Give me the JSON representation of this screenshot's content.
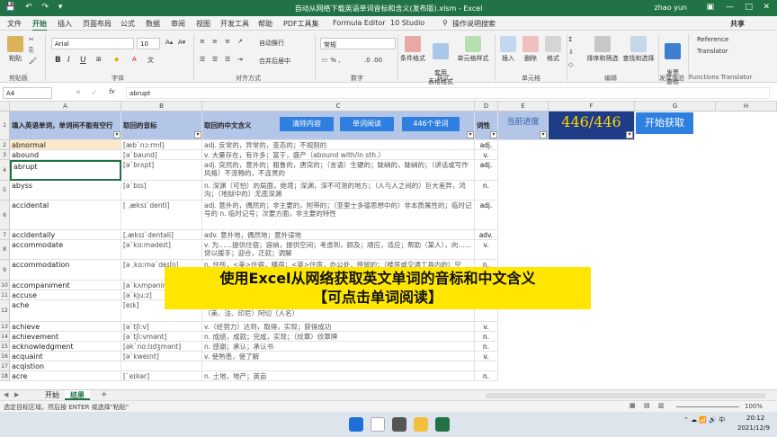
{
  "title_bar": {
    "title": "自动从网络下载英语单词音标和含义(发布版).xlsm - Excel",
    "user": "zhao yun",
    "minimize": "—",
    "maximize": "□",
    "close": "✕",
    "ribbon_display": "▣"
  },
  "quick_access": "💾 ↶ ↷ ▾",
  "tabs": [
    "文件",
    "开始",
    "插入",
    "页面布局",
    "公式",
    "数据",
    "审阅",
    "视图",
    "开发工具",
    "帮助",
    "PDF工具集",
    "Formula Editor",
    "10 Studio",
    "操作说明搜索"
  ],
  "share_label": "共享",
  "ribbon": {
    "paste": "粘贴",
    "font_name": "Arial",
    "font_size": "10",
    "bold": "B",
    "italic": "I",
    "underline": "U",
    "wrap": "自动换行",
    "merge": "合并后居中",
    "number_format": "常规",
    "cond_format": "条件格式",
    "table_format": "套用\n表格格式",
    "cell_style": "单元格样式",
    "insert": "插入",
    "delete": "删除",
    "format": "格式",
    "sort": "排序和筛选",
    "find": "查找和选择",
    "invoice_check": "发票\n查验",
    "reference": "Reference",
    "translator": "Translator",
    "groups": [
      "剪贴板",
      "字体",
      "对齐方式",
      "数字",
      "样式",
      "单元格",
      "编辑",
      "发票查验",
      "Functions Translator"
    ]
  },
  "formula_bar": {
    "name_box": "A4",
    "fx": "fx",
    "value": "abrupt"
  },
  "columns": [
    "A",
    "B",
    "C",
    "D",
    "E",
    "F",
    "G",
    "H"
  ],
  "header_row": {
    "a": "填入英语单词，单词间不能有空行",
    "b": "取回的音标",
    "c": "取回的中文含义",
    "d": "词性"
  },
  "buttons": {
    "clear": "清除内容",
    "read": "单词阅读",
    "count": "446个单词",
    "start": "开始获取"
  },
  "progress": {
    "label": "当前进度",
    "value": "446/446"
  },
  "rows": [
    {
      "n": "2",
      "word": "abnormal",
      "phon": "[æb`nɔ:rml]",
      "mean": "adj. 反常的，异常的，变态的；不规则的",
      "pos": "adj."
    },
    {
      "n": "3",
      "word": "abound",
      "phon": "[ə`baund]",
      "mean": "v. 大量存在，有许多；富于，盛产（abound with/in sth.）",
      "pos": "v."
    },
    {
      "n": "4",
      "word": "abrupt",
      "phon": "[ə`brʌpt]",
      "mean": "adj. 突然的，意外的；粗鲁的，唐突的；（言语）生硬的；陡峭的，陡峭的；（讲话或写作风格）不流畅的，不连贯的",
      "pos": "adj."
    },
    {
      "n": "5",
      "word": "abyss",
      "phon": "[ə`bɪs]",
      "mean": "n. 深渊（可怕）的局面，绝境；深渊，深不可测的地方；（人与人之间的）巨大差异，鸿沟；（地狱中的）无底深渊",
      "pos": "n."
    },
    {
      "n": "6",
      "word": "accidental",
      "phon": "[ ˌæksɪ`dentl]",
      "mean": "adj. 意外的，偶然的；非主要的，附带的；（亚里士多德思想中的）非本质属性的；临时记号的 n. 临时记号；次要方面，非主要的特性",
      "pos": "adj."
    },
    {
      "n": "7",
      "word": "accidentally",
      "phon": "[ˌæksɪ`dentəli]",
      "mean": "adv. 意外地，偶然地；意外误地",
      "pos": "adv."
    },
    {
      "n": "8",
      "word": "accommodate",
      "phon": "[ə`kɑ:mədeɪt]",
      "mean": "v. 为……提供住宿；容纳，提供空间；考虑到，顾及；顺应，适应；帮助（某人），向……贷以援手；迎合，迁就；调解",
      "pos": "v."
    },
    {
      "n": "9",
      "word": "accommodation",
      "phon": "[ə ˌkɑ:mə`deɪʃn]",
      "mean": "n. 住所，<美>住宿，膳宿；<英>住房，办公处，停留的；（楼房或交通工具内的）空间，座位",
      "pos": "n."
    },
    {
      "n": "10",
      "word": "accompaniment",
      "phon": "[ə`kʌmpənimənt]",
      "mean": "",
      "pos": ""
    },
    {
      "n": "11",
      "word": "accuse",
      "phon": "[ə`kju:z]",
      "mean": "",
      "pos": ""
    },
    {
      "n": "12",
      "word": "ache",
      "phon": "[eɪk]",
      "mean": "n.（身体某部位的）疼痛；（心中的）苦痛，痛苦，<文>渴望；<文>渴望 【名】（Ache）（美、法、印尼）阿切（人名）",
      "pos": "v."
    },
    {
      "n": "13",
      "word": "achieve",
      "phon": "[ə`tʃi:v]",
      "mean": "v.（经努力）达到，取得，实现；获得成功",
      "pos": "v."
    },
    {
      "n": "14",
      "word": "achievement",
      "phon": "[ə`tʃi:vmənt]",
      "mean": "n. 成绩，成就；完成，实现；（纹章）纹章牌",
      "pos": "n."
    },
    {
      "n": "15",
      "word": "acknowledgment",
      "phon": "[ək`nɑ:lɪdʒmənt]",
      "mean": "n. 感谢；承认；承认书",
      "pos": "n."
    },
    {
      "n": "16",
      "word": "acquaint",
      "phon": "[ə`kweɪnt]",
      "mean": "v. 使熟悉，使了解",
      "pos": "v."
    },
    {
      "n": "17",
      "word": "acqistion",
      "phon": "",
      "mean": "",
      "pos": ""
    },
    {
      "n": "18",
      "word": "acre",
      "phon": "[`eɪkər]",
      "mean": "n. 土地，地产；英亩",
      "pos": "n."
    }
  ],
  "caption": {
    "line1": "使用Excel从网络获取英文单词的音标和中文含义",
    "line2": "【可点击单词阅读】"
  },
  "sheet_tabs": [
    "开始",
    "结果"
  ],
  "add_sheet": "+",
  "status_text": "选定目标区域，然后按 ENTER 或选择\"粘贴\"",
  "zoom": "100%",
  "clock": {
    "time": "20:12",
    "date": "2021/12/9"
  }
}
